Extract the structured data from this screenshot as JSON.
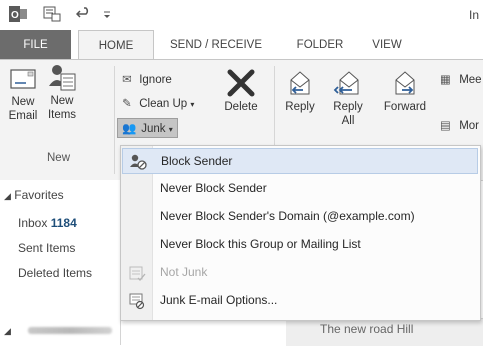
{
  "title_fragment": "In",
  "tabs": [
    {
      "label": "FILE"
    },
    {
      "label": "HOME"
    },
    {
      "label": "SEND / RECEIVE"
    },
    {
      "label": "FOLDER"
    },
    {
      "label": "VIEW"
    }
  ],
  "ribbon": {
    "new_email": "New Email",
    "new_items": "New Items",
    "new_group": "New",
    "ignore": "Ignore",
    "clean_up": "Clean Up",
    "junk": "Junk",
    "delete": "Delete",
    "reply": "Reply",
    "reply_all": "Reply All",
    "forward": "Forward",
    "meeting_fragment": "Mee",
    "more_fragment": "Mor"
  },
  "nav": {
    "favorites": "Favorites",
    "inbox": "Inbox",
    "inbox_count": "1184",
    "sent": "Sent Items",
    "deleted": "Deleted Items"
  },
  "junk_menu": [
    {
      "label": "Block Sender",
      "icon": "block-sender-icon",
      "enabled": true,
      "highlighted": true
    },
    {
      "label": "Never Block Sender",
      "icon": "",
      "enabled": true,
      "highlighted": false
    },
    {
      "label": "Never Block Sender's Domain (@example.com)",
      "icon": "",
      "enabled": true,
      "highlighted": false
    },
    {
      "label": "Never Block this Group or Mailing List",
      "icon": "",
      "enabled": true,
      "highlighted": false
    },
    {
      "label": "Not Junk",
      "icon": "not-junk-icon",
      "enabled": false,
      "highlighted": false
    },
    {
      "label": "Junk E-mail Options...",
      "icon": "junk-options-icon",
      "enabled": true,
      "highlighted": false
    }
  ],
  "reading": {
    "road_text": "The new road Hill"
  }
}
